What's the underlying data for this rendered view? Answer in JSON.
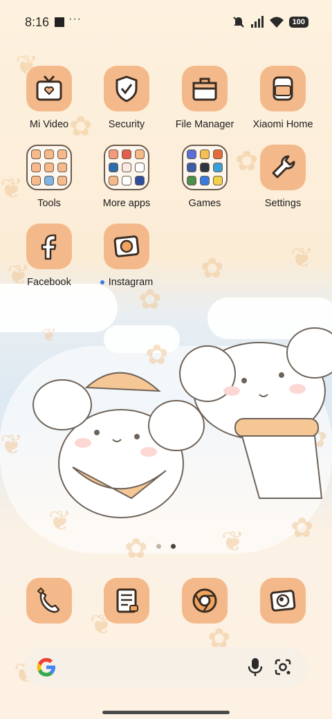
{
  "status_bar": {
    "time": "8:16",
    "more_indicator": "···",
    "battery": "100",
    "icons": [
      "mute-icon",
      "signal-icon",
      "wifi-icon",
      "battery-icon"
    ]
  },
  "apps": {
    "row1": [
      {
        "label": "Mi Video",
        "icon": "tv-icon"
      },
      {
        "label": "Security",
        "icon": "shield-icon"
      },
      {
        "label": "File Manager",
        "icon": "briefcase-icon"
      },
      {
        "label": "Xiaomi Home",
        "icon": "jar-icon"
      }
    ],
    "row2": [
      {
        "label": "Tools",
        "icon": "folder-icon"
      },
      {
        "label": "More apps",
        "icon": "folder-icon"
      },
      {
        "label": "Games",
        "icon": "folder-icon"
      },
      {
        "label": "Settings",
        "icon": "wrench-icon"
      }
    ],
    "row3": [
      {
        "label": "Facebook",
        "icon": "facebook-icon"
      },
      {
        "label": "Instagram",
        "icon": "camera-icon"
      }
    ]
  },
  "dock": [
    {
      "name": "phone",
      "icon": "phone-icon"
    },
    {
      "name": "notes",
      "icon": "notes-icon"
    },
    {
      "name": "chrome",
      "icon": "chrome-icon"
    },
    {
      "name": "camera",
      "icon": "camera-icon"
    }
  ],
  "page_indicator": {
    "count": 2,
    "active": 2
  },
  "search": {
    "logo": "google-icon",
    "mic": "mic-icon",
    "lens": "lens-icon"
  },
  "colors": {
    "icon_bg": "#f4b98a",
    "outline": "#3a2c22",
    "accent_blue": "#3a7be0"
  }
}
